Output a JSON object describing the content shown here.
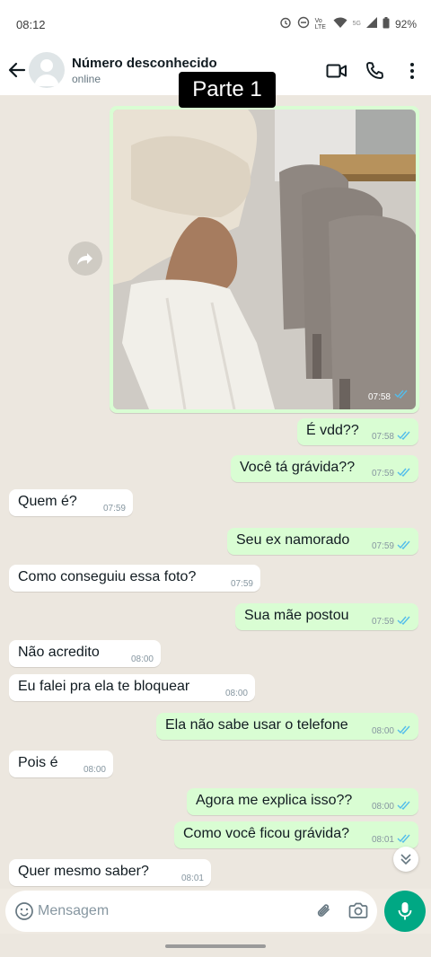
{
  "status_bar": {
    "time": "08:12",
    "volte_label": "Vo LTE",
    "signal_label": "5G",
    "battery": "92%"
  },
  "header": {
    "contact_name": "Número desconhecido",
    "presence": "online"
  },
  "overlay": {
    "label": "Parte 1"
  },
  "image_message": {
    "time": "07:58",
    "status": "read"
  },
  "messages": [
    {
      "dir": "out",
      "text": "É vdd??",
      "time": "07:58"
    },
    {
      "dir": "out",
      "text": "Você tá grávida??",
      "time": "07:59"
    },
    {
      "dir": "in",
      "text": "Quem é?",
      "time": "07:59"
    },
    {
      "dir": "out",
      "text": "Seu ex namorado",
      "time": "07:59"
    },
    {
      "dir": "in",
      "text": "Como conseguiu essa foto?",
      "time": "07:59"
    },
    {
      "dir": "out",
      "text": "Sua mãe postou",
      "time": "07:59"
    },
    {
      "dir": "in",
      "text": "Não acredito",
      "time": "08:00"
    },
    {
      "dir": "in",
      "text": "Eu falei pra ela te bloquear",
      "time": "08:00"
    },
    {
      "dir": "out",
      "text": "Ela não sabe usar o telefone",
      "time": "08:00"
    },
    {
      "dir": "in",
      "text": "Pois é",
      "time": "08:00"
    },
    {
      "dir": "out",
      "text": "Agora me explica isso??",
      "time": "08:00"
    },
    {
      "dir": "out",
      "text": "Como você ficou grávida?",
      "time": "08:01"
    },
    {
      "dir": "in",
      "text": "Quer mesmo saber?",
      "time": "08:01"
    }
  ],
  "composer": {
    "placeholder": "Mensagem",
    "value": ""
  },
  "colors": {
    "accent": "#00a884",
    "outgoing_bubble": "#d9fdd3",
    "incoming_bubble": "#ffffff",
    "read_ticks": "#53bdeb",
    "chat_background": "#ece7df"
  }
}
